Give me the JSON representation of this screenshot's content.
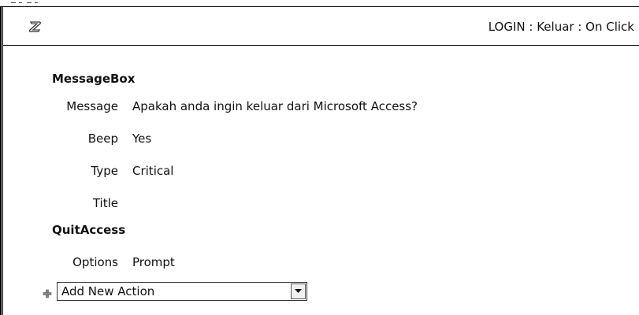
{
  "header": {
    "title": "LOGIN : Keluar : On Click",
    "icon": "macro-icon"
  },
  "actions": [
    {
      "name": "MessageBox",
      "arguments": [
        {
          "label": "Message",
          "value": "Apakah anda ingin keluar dari Microsoft Access?"
        },
        {
          "label": "Beep",
          "value": "Yes"
        },
        {
          "label": "Type",
          "value": "Critical"
        },
        {
          "label": "Title",
          "value": ""
        }
      ]
    },
    {
      "name": "QuitAccess",
      "arguments": [
        {
          "label": "Options",
          "value": "Prompt"
        }
      ]
    }
  ],
  "add_action": {
    "value": "Add New Action",
    "icon": "plus-icon",
    "dropdown_icon": "chevron-down-icon"
  }
}
